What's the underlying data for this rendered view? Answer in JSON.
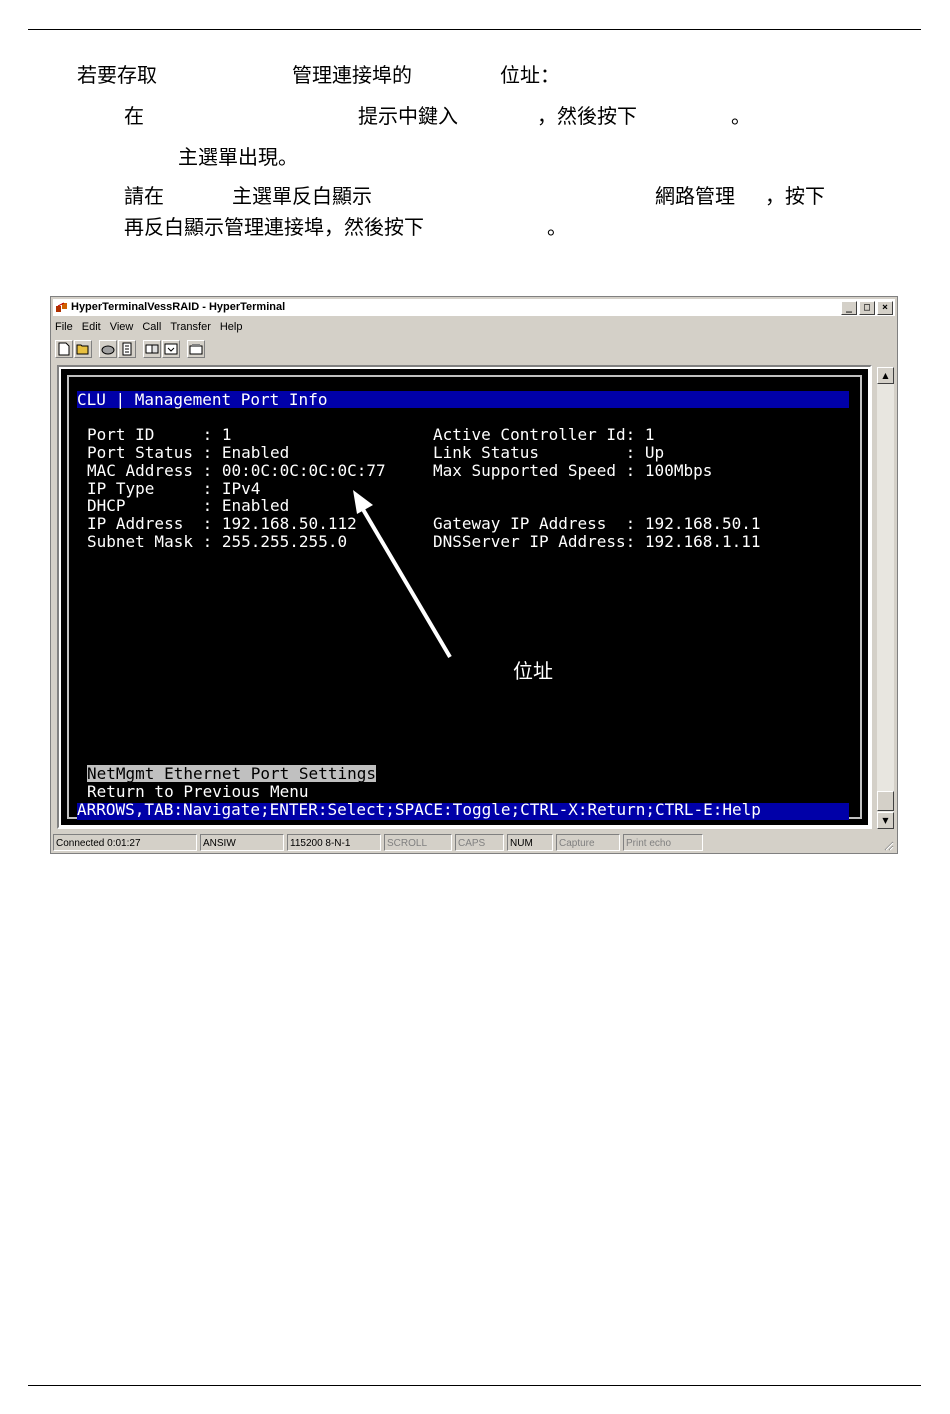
{
  "doc": {
    "intro": {
      "a": "若要存取",
      "b": "管理連接埠的",
      "c": "位址："
    },
    "step1": {
      "a": "在",
      "b": "提示中鍵入",
      "c": "，然後按下",
      "d": "。"
    },
    "step1_result": "主選單出現。",
    "step2": {
      "a": "請在",
      "b": "主選單反白顯示",
      "c": "網路管理",
      "d": "，按下"
    },
    "step2_line2": {
      "a": "再反白顯示管理連接埠，然後按下",
      "b": "。"
    }
  },
  "window": {
    "title": "HyperTerminalVessRAID - HyperTerminal",
    "buttons": {
      "minimize": "_",
      "maximize": "□",
      "close": "×"
    },
    "menu": [
      "File",
      "Edit",
      "View",
      "Call",
      "Transfer",
      "Help"
    ]
  },
  "terminal": {
    "header": "CLU | Management Port Info",
    "left_rows": [
      "Port ID     : 1",
      "Port Status : Enabled",
      "MAC Address : 00:0C:0C:0C:0C:77",
      "IP Type     : IPv4",
      "DHCP        : Enabled",
      "IP Address  : 192.168.50.112",
      "Subnet Mask : 255.255.255.0"
    ],
    "right_rows": [
      "Active Controller Id: 1",
      "Link Status         : Up",
      "Max Supported Speed : 100Mbps",
      "",
      "",
      "Gateway IP Address  : 192.168.50.1",
      "DNSServer IP Address: 192.168.1.11"
    ],
    "menu_selected": "NetMgmt Ethernet Port Settings",
    "menu_other": "Return to Previous Menu",
    "help": "ARROWS,TAB:Navigate;ENTER:Select;SPACE:Toggle;CTRL-X:Return;CTRL-E:Help"
  },
  "callout": "位址",
  "statusbar": {
    "connected": "Connected 0:01:27",
    "emulation": "ANSIW",
    "settings": "115200 8-N-1",
    "scroll": "SCROLL",
    "caps": "CAPS",
    "num": "NUM",
    "capture": "Capture",
    "print_echo": "Print echo"
  },
  "colors": {
    "terminal_bg": "#000000",
    "terminal_text": "#ffffff",
    "highlight_bar": "#0000a8",
    "window_chrome": "#d4d0c8"
  }
}
